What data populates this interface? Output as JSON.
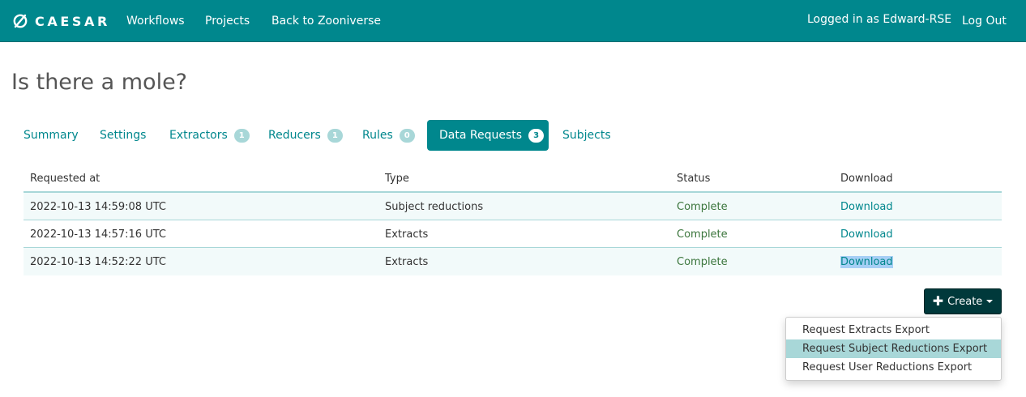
{
  "colors": {
    "brand": "#00878d",
    "badge": "#a8d7d8",
    "status_complete": "#3c763d",
    "create_button": "#00393b"
  },
  "navbar": {
    "brand": "CAESAR",
    "brand_icon": "caesar-slashed-circle-logo",
    "links": [
      "Workflows",
      "Projects",
      "Back to Zooniverse"
    ],
    "user_text": "Logged in as Edward-RSE",
    "logout": "Log Out"
  },
  "page": {
    "title": "Is there a mole?"
  },
  "tabs": [
    {
      "label": "Summary",
      "badge": null,
      "active": false
    },
    {
      "label": "Settings",
      "badge": null,
      "active": false
    },
    {
      "label": "Extractors",
      "badge": "1",
      "active": false
    },
    {
      "label": "Reducers",
      "badge": "1",
      "active": false
    },
    {
      "label": "Rules",
      "badge": "0",
      "active": false
    },
    {
      "label": "Data Requests",
      "badge": "3",
      "active": true
    },
    {
      "label": "Subjects",
      "badge": null,
      "active": false
    }
  ],
  "table": {
    "headers": [
      "Requested at",
      "Type",
      "Status",
      "Download"
    ],
    "rows": [
      {
        "requested_at": "2022-10-13 14:59:08 UTC",
        "type": "Subject reductions",
        "status": "Complete",
        "download": "Download"
      },
      {
        "requested_at": "2022-10-13 14:57:16 UTC",
        "type": "Extracts",
        "status": "Complete",
        "download": "Download"
      },
      {
        "requested_at": "2022-10-13 14:52:22 UTC",
        "type": "Extracts",
        "status": "Complete",
        "download": "Download"
      }
    ]
  },
  "create": {
    "label": "Create",
    "menu": [
      "Request Extracts Export",
      "Request Subject Reductions Export",
      "Request User Reductions Export"
    ]
  }
}
